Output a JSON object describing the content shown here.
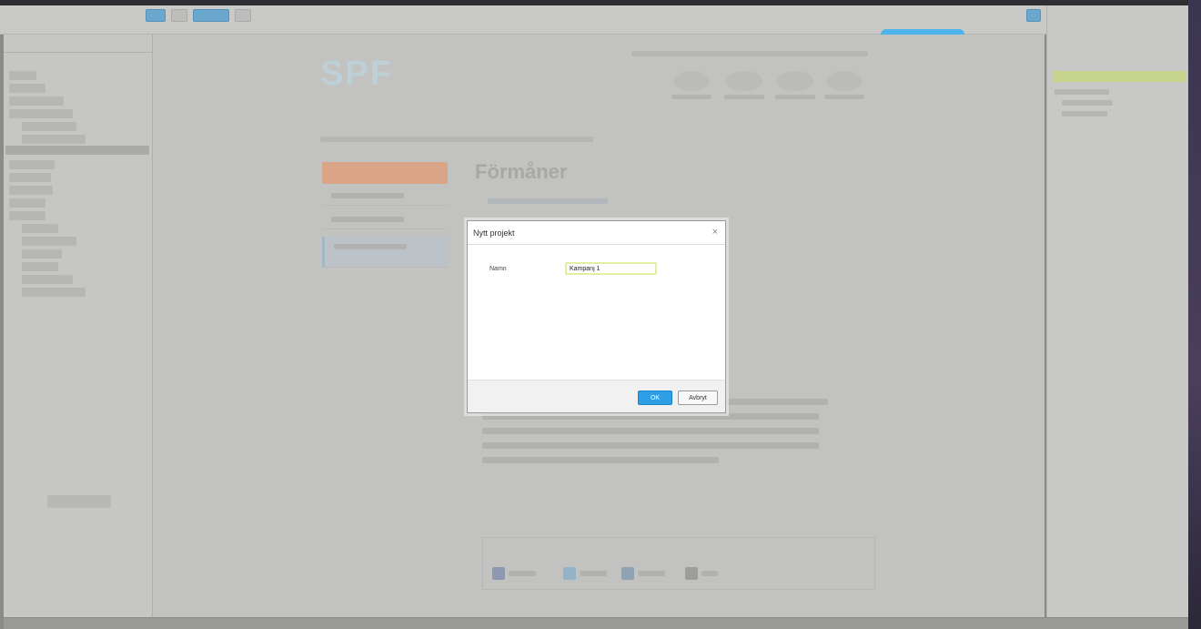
{
  "page": {
    "heading": "Förmåner"
  },
  "modal": {
    "title": "Nytt projekt",
    "close_glyph": "×",
    "name_label": "Namn",
    "name_value": "Kampanj 1",
    "ok_label": "OK",
    "cancel_label": "Avbryt"
  },
  "colors": {
    "ok_button": "#2e9ee6",
    "input_focus": "#e3ef9e",
    "tree_selected": "#c6d38a"
  },
  "icons": {
    "close": "close-icon"
  }
}
